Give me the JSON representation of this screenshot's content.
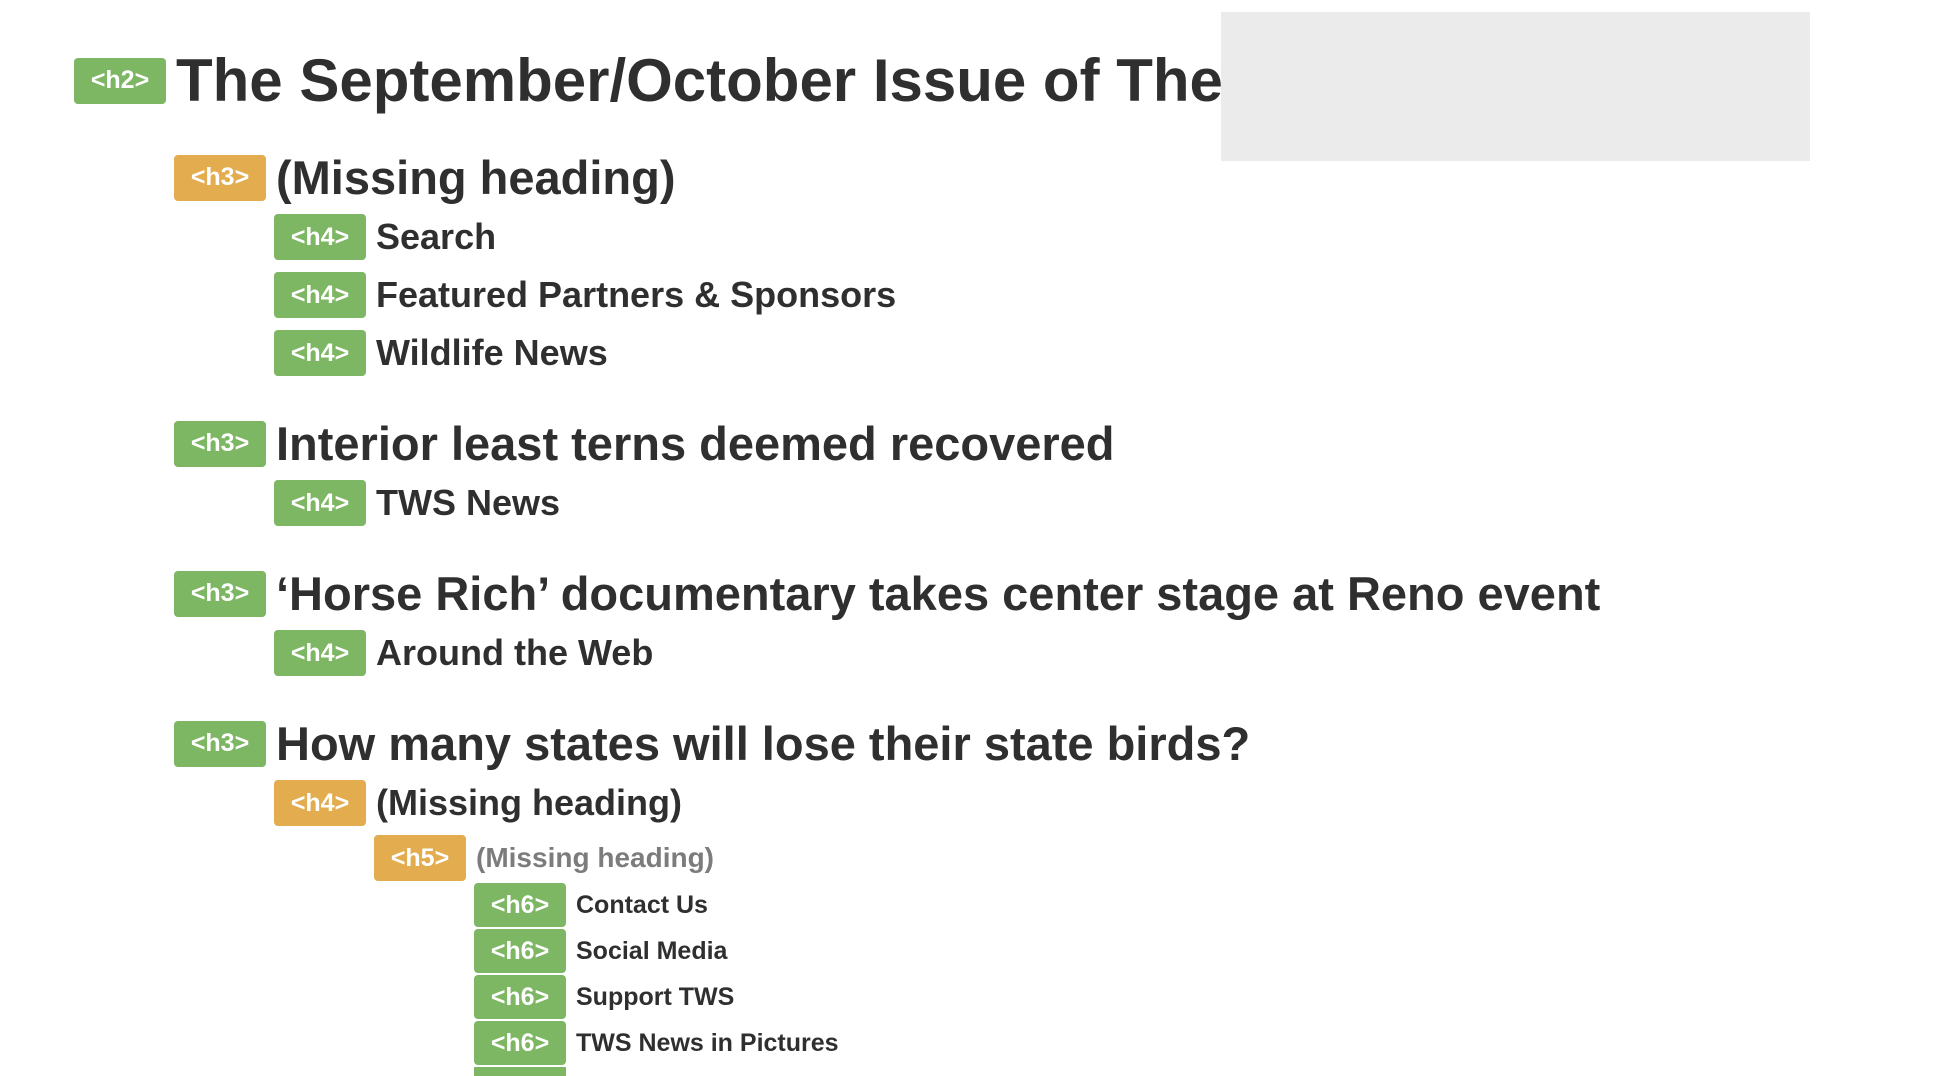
{
  "outline": {
    "h2_title": {
      "tag": "<h2>",
      "text": "The September/October Issue of The"
    },
    "missing_label": "(Missing heading)",
    "items": [
      {
        "tag": "<h3>",
        "text": "(Missing heading)"
      },
      {
        "tag": "<h4>",
        "text": "Search"
      },
      {
        "tag": "<h4>",
        "text": "Featured Partners & Sponsors"
      },
      {
        "tag": "<h4>",
        "text": "Wildlife News"
      },
      {
        "tag": "<h3>",
        "text": "Interior least terns deemed recovered"
      },
      {
        "tag": "<h4>",
        "text": "TWS News"
      },
      {
        "tag": "<h3>",
        "text": "‘Horse Rich’ documentary takes center stage at Reno event"
      },
      {
        "tag": "<h4>",
        "text": "Around the Web"
      },
      {
        "tag": "<h3>",
        "text": "How many states will lose their state birds?"
      },
      {
        "tag": "<h4>",
        "text": "(Missing heading)"
      },
      {
        "tag": "<h5>",
        "text": "(Missing heading)"
      },
      {
        "tag": "<h6>",
        "text": "Contact Us"
      },
      {
        "tag": "<h6>",
        "text": "Social Media"
      },
      {
        "tag": "<h6>",
        "text": "Support TWS"
      },
      {
        "tag": "<h6>",
        "text": "TWS News in Pictures"
      }
    ]
  },
  "colors": {
    "tag_ok": "#7db764",
    "tag_missing": "#e3ad4f",
    "placeholder": "#ebebeb",
    "missing_text": "#7c7c7c"
  }
}
